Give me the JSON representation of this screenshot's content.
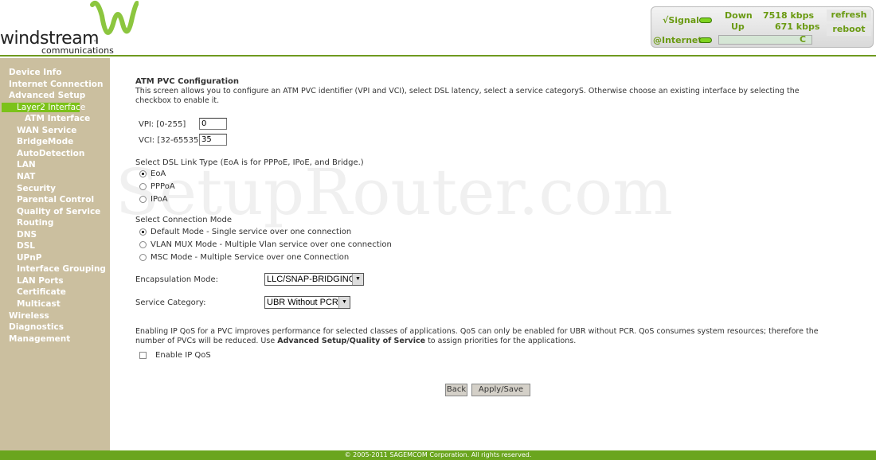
{
  "logo": {
    "name": "windstream",
    "tm": "™",
    "tagline": "communications"
  },
  "status": {
    "signal": "√Signal",
    "internet": "@Internet",
    "down_label": "Down",
    "up_label": "Up",
    "down_rate": "7518 kbps",
    "up_rate": "671 kbps",
    "conn_letter": "C",
    "refresh": "refresh",
    "reboot": "reboot"
  },
  "sidebar": {
    "items": [
      {
        "label": "Device Info",
        "level": 0
      },
      {
        "label": "Internet Connection",
        "level": 0
      },
      {
        "label": "Advanced Setup",
        "level": 0
      },
      {
        "label": "Layer2 Interface",
        "level": 1,
        "active": true
      },
      {
        "label": "ATM Interface",
        "level": 2
      },
      {
        "label": "WAN Service",
        "level": 1
      },
      {
        "label": "BridgeMode",
        "level": 1
      },
      {
        "label": "AutoDetection",
        "level": 1
      },
      {
        "label": "LAN",
        "level": 1
      },
      {
        "label": "NAT",
        "level": 1
      },
      {
        "label": "Security",
        "level": 1
      },
      {
        "label": "Parental Control",
        "level": 1
      },
      {
        "label": "Quality of Service",
        "level": 1
      },
      {
        "label": "Routing",
        "level": 1
      },
      {
        "label": "DNS",
        "level": 1
      },
      {
        "label": "DSL",
        "level": 1
      },
      {
        "label": "UPnP",
        "level": 1
      },
      {
        "label": "Interface Grouping",
        "level": 1
      },
      {
        "label": "LAN Ports",
        "level": 1
      },
      {
        "label": "Certificate",
        "level": 1
      },
      {
        "label": "Multicast",
        "level": 1
      },
      {
        "label": "Wireless",
        "level": 0
      },
      {
        "label": "Diagnostics",
        "level": 0
      },
      {
        "label": "Management",
        "level": 0
      }
    ]
  },
  "main": {
    "title": "ATM PVC Configuration",
    "description": "This screen allows you to configure an ATM PVC identifier (VPI and VCI), select DSL latency, select a service categoryS. Otherwise choose an existing interface by selecting the checkbox to enable it.",
    "vpi_label": "VPI: [0-255]",
    "vpi_value": "0",
    "vci_label": "VCI: [32-65535]",
    "vci_value": "35",
    "link_type_label": "Select DSL Link Type (EoA is for PPPoE, IPoE, and Bridge.)",
    "link_types": [
      {
        "label": "EoA",
        "checked": true
      },
      {
        "label": "PPPoA",
        "checked": false
      },
      {
        "label": "IPoA",
        "checked": false
      }
    ],
    "conn_mode_label": "Select Connection Mode",
    "conn_modes": [
      {
        "label": "Default Mode - Single service over one connection",
        "checked": true
      },
      {
        "label": "VLAN MUX Mode - Multiple Vlan service over one connection",
        "checked": false
      },
      {
        "label": "MSC Mode - Multiple Service over one Connection",
        "checked": false
      }
    ],
    "encap_label": "Encapsulation Mode:",
    "encap_value": "LLC/SNAP-BRIDGING",
    "service_label": "Service Category:",
    "service_value": "UBR Without PCR",
    "qos_text_1": "Enabling IP QoS for a PVC improves performance for selected classes of applications.   QoS can only be enabled for UBR without PCR. QoS consumes system resources; therefore the number of PVCs will be reduced. Use ",
    "qos_link": "Advanced Setup/Quality of Service",
    "qos_text_2": " to assign priorities for the applications.",
    "qos_checkbox_label": "Enable IP QoS",
    "qos_checked": false,
    "back": "Back",
    "apply": "Apply/Save"
  },
  "watermark": "SetupRouter.com",
  "footer": "© 2005-2011 SAGEMCOM Corporation. All rights reserved.",
  "colors": {
    "accent": "#6aa51e",
    "sidebar": "#cbbf9f",
    "active": "#7cc21a"
  }
}
